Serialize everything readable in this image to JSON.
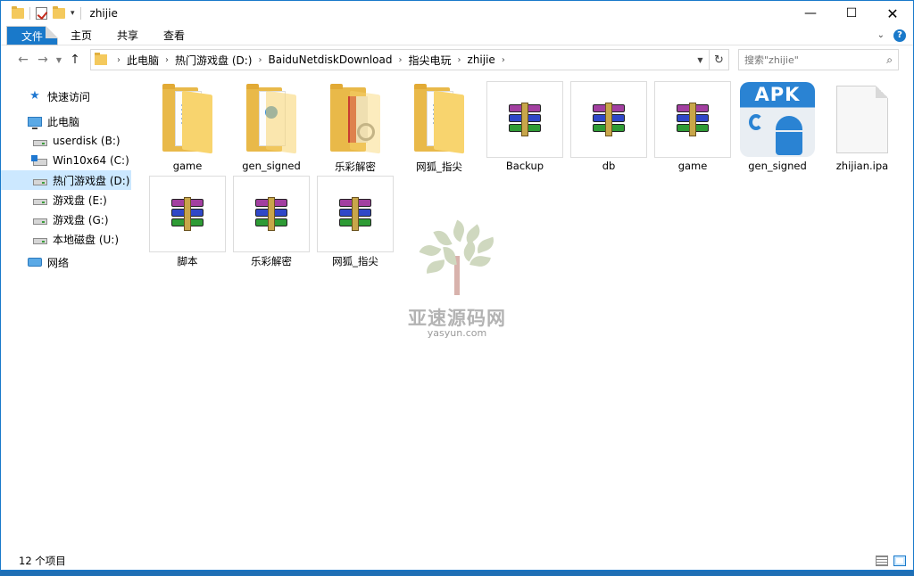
{
  "window": {
    "title": "zhijie"
  },
  "ribbon": {
    "file": "文件",
    "home": "主页",
    "share": "共享",
    "view": "查看"
  },
  "address": {
    "crumbs": [
      "此电脑",
      "热门游戏盘 (D:)",
      "BaiduNetdiskDownload",
      "指尖电玩",
      "zhijie"
    ]
  },
  "search": {
    "placeholder": "搜索\"zhijie\""
  },
  "sidebar": {
    "items": [
      {
        "label": "快速访问",
        "icon": "star-icon"
      },
      {
        "label": "此电脑",
        "icon": "computer-icon"
      },
      {
        "label": "userdisk (B:)",
        "icon": "drive-icon"
      },
      {
        "label": "Win10x64 (C:)",
        "icon": "windows-drive-icon"
      },
      {
        "label": "热门游戏盘 (D:)",
        "icon": "drive-icon",
        "selected": true
      },
      {
        "label": "游戏盘 (E:)",
        "icon": "drive-icon"
      },
      {
        "label": "游戏盘 (G:)",
        "icon": "drive-icon"
      },
      {
        "label": "本地磁盘 (U:)",
        "icon": "drive-icon"
      },
      {
        "label": "网络",
        "icon": "network-icon"
      }
    ]
  },
  "files": [
    {
      "name": "game",
      "type": "folder"
    },
    {
      "name": "gen_signed",
      "type": "folder"
    },
    {
      "name": "乐彩解密",
      "type": "folder"
    },
    {
      "name": "网狐_指尖",
      "type": "folder"
    },
    {
      "name": "Backup",
      "type": "rar"
    },
    {
      "name": "db",
      "type": "rar"
    },
    {
      "name": "game",
      "type": "rar"
    },
    {
      "name": "gen_signed",
      "type": "apk"
    },
    {
      "name": "zhijian.ipa",
      "type": "file"
    },
    {
      "name": "脚本",
      "type": "rar"
    },
    {
      "name": "乐彩解密",
      "type": "rar"
    },
    {
      "name": "网狐_指尖",
      "type": "rar"
    }
  ],
  "apk_badge": "APK",
  "watermark": {
    "title": "亚速源码网",
    "url": "yasyun.com"
  },
  "status": {
    "count": "12 个项目"
  }
}
